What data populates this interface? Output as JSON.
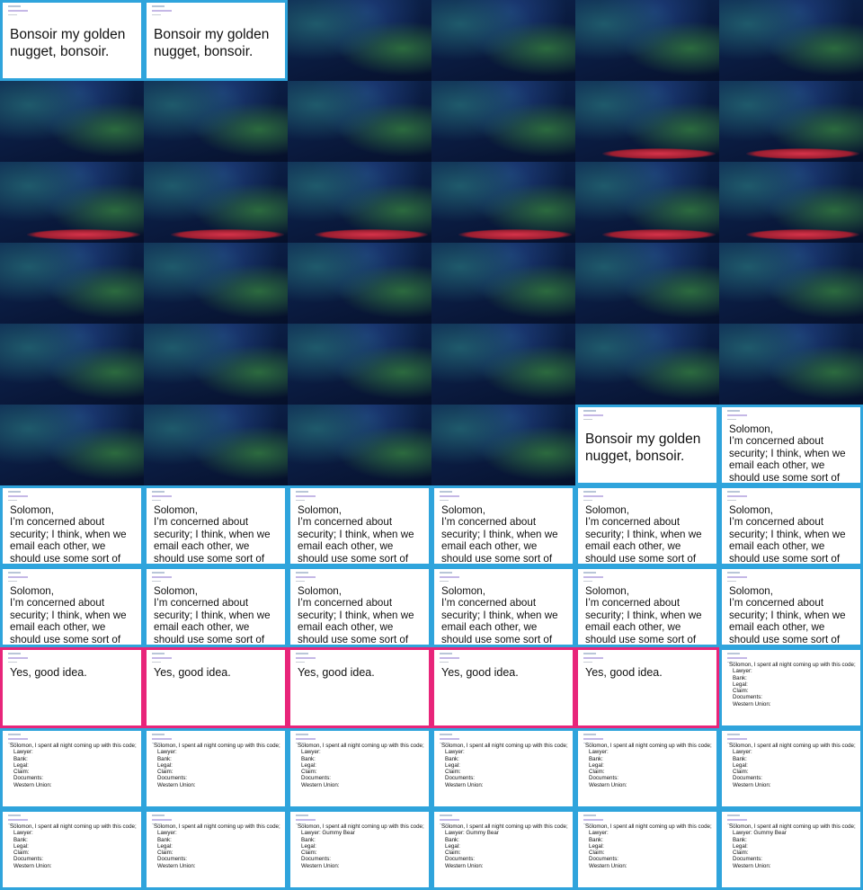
{
  "slides": {
    "bonsoir": "Bonsoir my golden nugget, bonsoir.",
    "solomon_salutation": "Solomon,",
    "solomon_body": "I’m concerned about security; I think, when we email each other, we should use some sort of code.",
    "yes_good_idea": "Yes, good idea.",
    "code_intro": "Solomon, I spent all night coming up with this code;",
    "code_lines": [
      "Lawyer:",
      "Bank:",
      "Legal:",
      "Claim:",
      "Documents:",
      "Western Union:"
    ],
    "lawyer_value": "Gummy Bear"
  },
  "colors": {
    "card_border_blue": "#2fa4dc",
    "card_border_pink": "#e8257a",
    "stage_red": "#d6334a"
  },
  "grid": {
    "columns": 6,
    "rows": 11,
    "frames": [
      "bonsoir",
      "bonsoir",
      "closeup",
      "wide",
      "wide",
      "wide",
      "wide",
      "wide",
      "wide",
      "wide",
      "stage",
      "stage",
      "stage",
      "stage",
      "stage",
      "stage",
      "stage",
      "stage",
      "face",
      "face",
      "face",
      "face",
      "face",
      "face",
      "face",
      "face",
      "face",
      "face",
      "wide",
      "wide",
      "wide",
      "wide",
      "wide",
      "wide",
      "bonsoir",
      "solomon",
      "solomon",
      "solomon",
      "solomon",
      "solomon",
      "solomon",
      "solomon",
      "solomon",
      "solomon",
      "solomon",
      "solomon",
      "solomon",
      "solomon",
      "yes",
      "yes",
      "yes",
      "yes",
      "yes",
      "code",
      "code",
      "code",
      "code",
      "code",
      "code",
      "code",
      "code",
      "code",
      "code_gummy",
      "code_gummy",
      "code",
      "code_gummy"
    ]
  }
}
